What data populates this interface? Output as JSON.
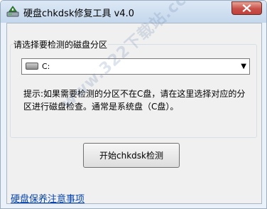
{
  "window": {
    "title": "硬盘chkdsk修复工具 v4.0",
    "icons": {
      "app": "disk-repair-app-icon",
      "close": "close-x-icon"
    }
  },
  "partition": {
    "group_label": "请选择要检测的磁盘分区",
    "selected": "C:",
    "drive_icon": "hard-drive-icon",
    "dropdown_icon": "triangle-down-icon"
  },
  "hint": "提示:如果需要检测的分区不在C盘，请在这里选择对应的分区进行磁盘检查。通常是系统盘（C盘）。",
  "actions": {
    "start_label": "开始chkdsk检测"
  },
  "link": {
    "label": "硬盘保养注意事项"
  },
  "watermark": "www.322下载站.cc",
  "colors": {
    "frame": "#eaf1f9",
    "client": "#f0f0f0",
    "close_button": "#c75049",
    "link": "#0645ad"
  }
}
